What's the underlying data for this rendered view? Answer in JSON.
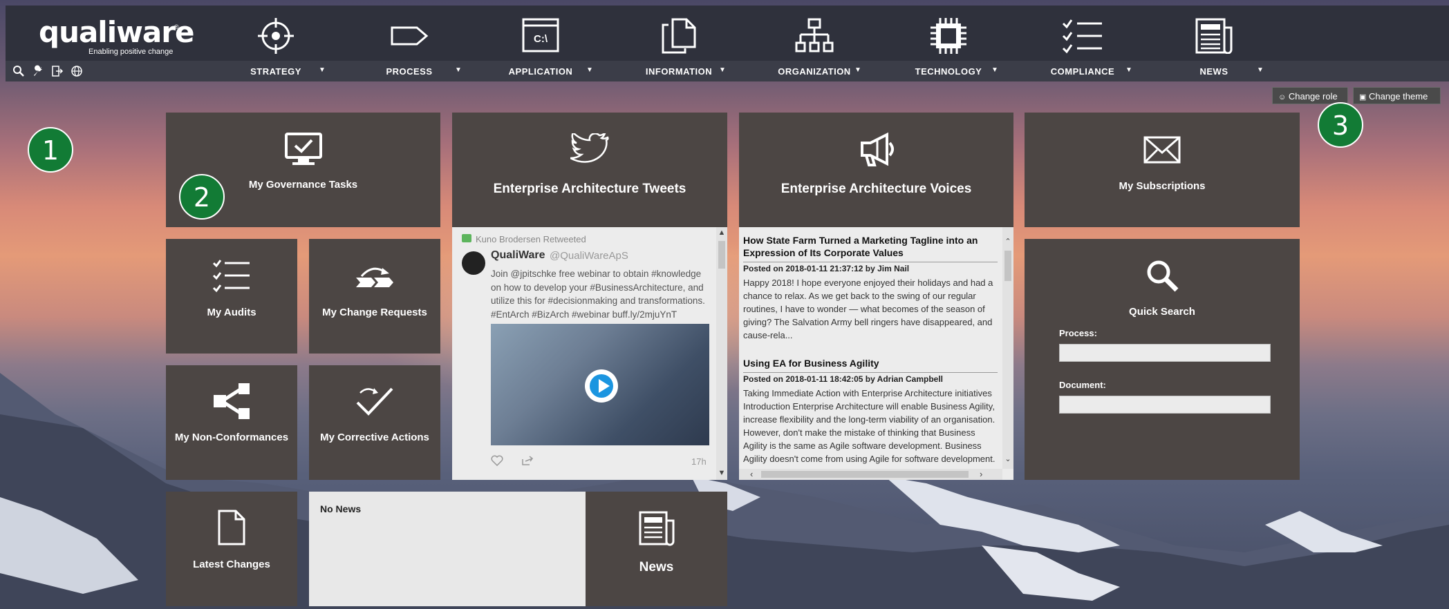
{
  "header": {
    "logo_text": "qualiware",
    "logo_reg": "®",
    "logo_tagline": "Enabling positive change",
    "util_icons": [
      "search-icon",
      "wrench-icon",
      "logout-icon",
      "globe-icon"
    ],
    "nav": [
      {
        "label": "STRATEGY",
        "icon": "target-icon"
      },
      {
        "label": "PROCESS",
        "icon": "tag-icon"
      },
      {
        "label": "APPLICATION",
        "icon": "console-icon",
        "icon_text": "C:\\"
      },
      {
        "label": "INFORMATION",
        "icon": "documents-icon"
      },
      {
        "label": "ORGANIZATION",
        "icon": "org-chart-icon"
      },
      {
        "label": "TECHNOLOGY",
        "icon": "chip-icon"
      },
      {
        "label": "COMPLIANCE",
        "icon": "checklist-icon"
      },
      {
        "label": "NEWS",
        "icon": "newspaper-icon"
      }
    ],
    "caret": "▼"
  },
  "buttons": {
    "change_role": "Change role",
    "change_theme": "Change theme"
  },
  "badges": [
    "1",
    "2",
    "3"
  ],
  "tiles": {
    "governance": "My Governance Tasks",
    "tweets_title": "Enterprise Architecture Tweets",
    "voices_title": "Enterprise Architecture Voices",
    "subscriptions": "My Subscriptions",
    "audits": "My Audits",
    "change_requests": "My Change Requests",
    "non_conformances": "My Non-Conformances",
    "corrective_actions": "My Corrective Actions",
    "quick_search": "Quick Search",
    "latest_changes": "Latest Changes",
    "news": "News",
    "no_news": "No News"
  },
  "tweet": {
    "retweet_by": "Kuno Brodersen Retweeted",
    "name": "QualiWare",
    "handle": "@QualiWareApS",
    "text": "Join @jpitschke free webinar to obtain #knowledge on how to develop your #BusinessArchitecture, and utilize this for #decisionmaking and transformations. #EntArch #BizArch #webinar buff.ly/2mjuYnT",
    "time": "17h"
  },
  "voices": [
    {
      "title": "How State Farm Turned a Marketing Tagline into an Expression of Its Corporate Values",
      "meta": "Posted on 2018-01-11 21:37:12 by Jim Nail",
      "body": "Happy 2018! I hope everyone enjoyed their holidays and had a chance to relax. As we get back to the swing of our regular routines, I have to wonder — what becomes of the season of giving? The Salvation Army bell ringers have disappeared, and cause-rela..."
    },
    {
      "title": "Using EA for Business Agility",
      "meta": "Posted on 2018-01-11 18:42:05 by Adrian Campbell",
      "body": "Taking Immediate Action with Enterprise Architecture initiatives Introduction Enterprise Architecture will enable Business Agility, increase flexibility and the long-term viability of an organisation. However, don't make the mistake of thinking that Business Agility is the same as Agile software development. Business Agility doesn't come from using Agile for software development. They are two different concepts. [...]"
    }
  ],
  "quick_search": {
    "process_label": "Process:",
    "document_label": "Document:"
  }
}
